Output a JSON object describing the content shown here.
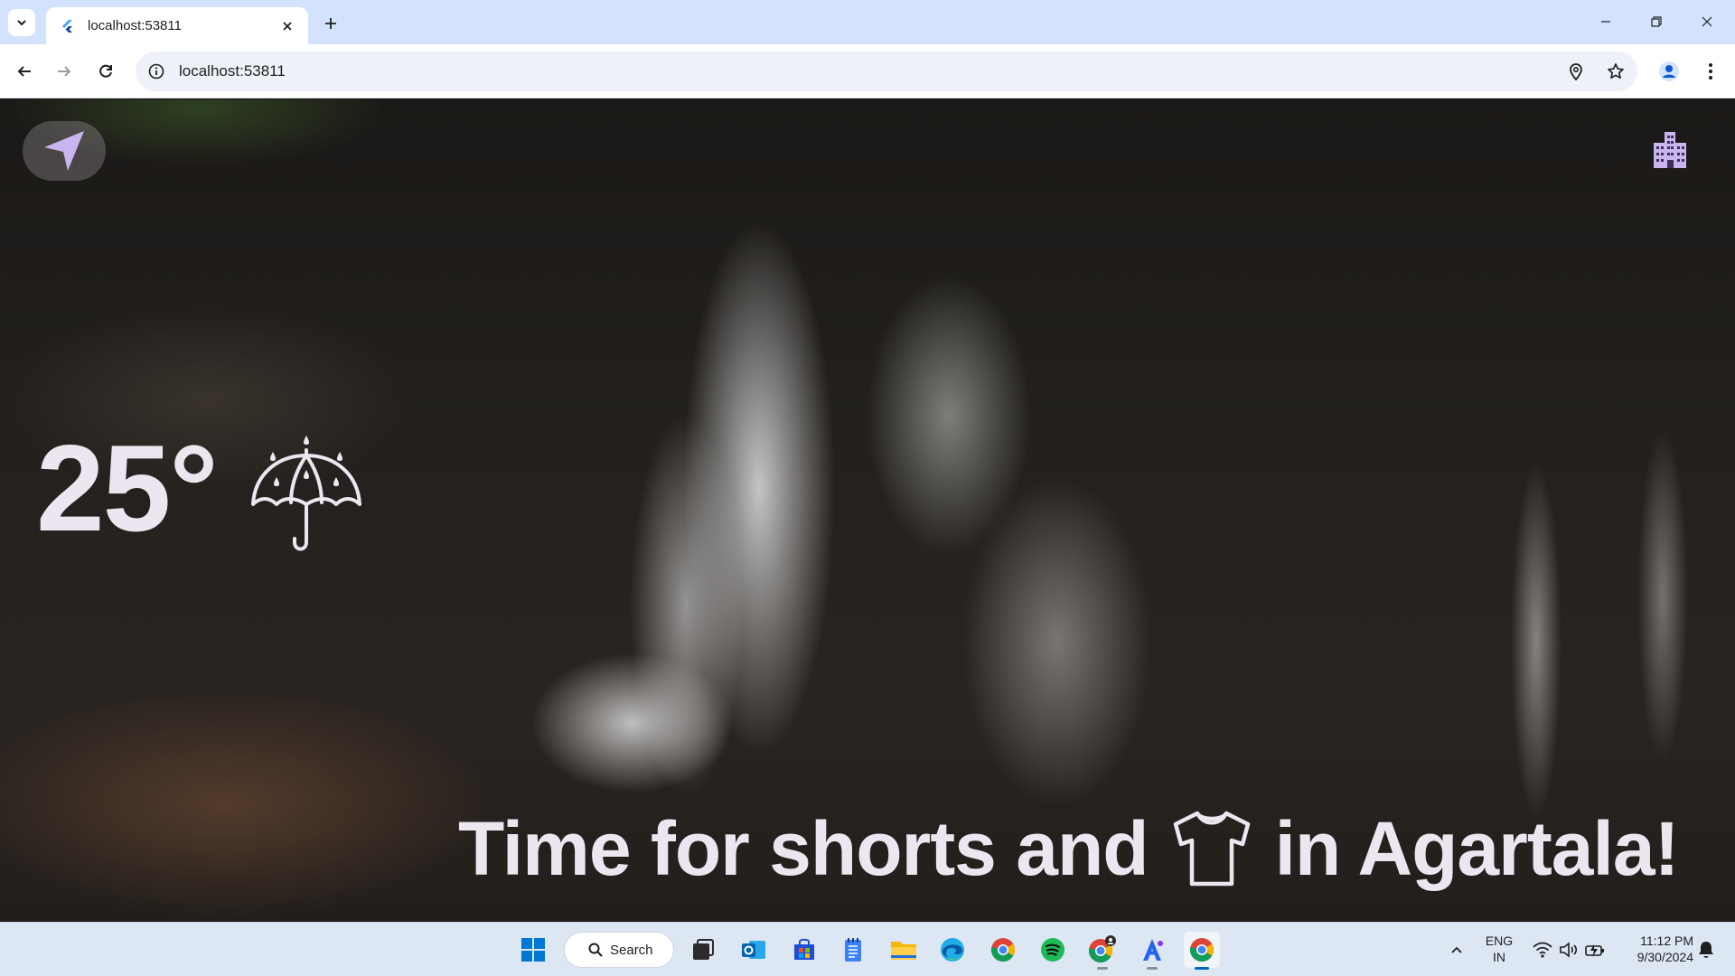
{
  "browser": {
    "tab_title": "localhost:53811",
    "url": "localhost:53811"
  },
  "app": {
    "temperature": "25°",
    "weather_icon": "umbrella-rain-icon",
    "message_before": "Time for shorts and",
    "message_icon": "t-shirt-icon",
    "message_after": "in Agartala!",
    "colors": {
      "text": "#ece6f0",
      "accent": "#c9b6f0"
    }
  },
  "taskbar": {
    "search_label": "Search",
    "language": "ENG",
    "region": "IN",
    "time": "11:12 PM",
    "date": "9/30/2024",
    "apps": [
      "start",
      "search",
      "task-view",
      "outlook",
      "store",
      "notepad",
      "file-explorer",
      "edge",
      "chrome",
      "spotify",
      "chrome-profile",
      "translate",
      "chrome-active"
    ]
  }
}
